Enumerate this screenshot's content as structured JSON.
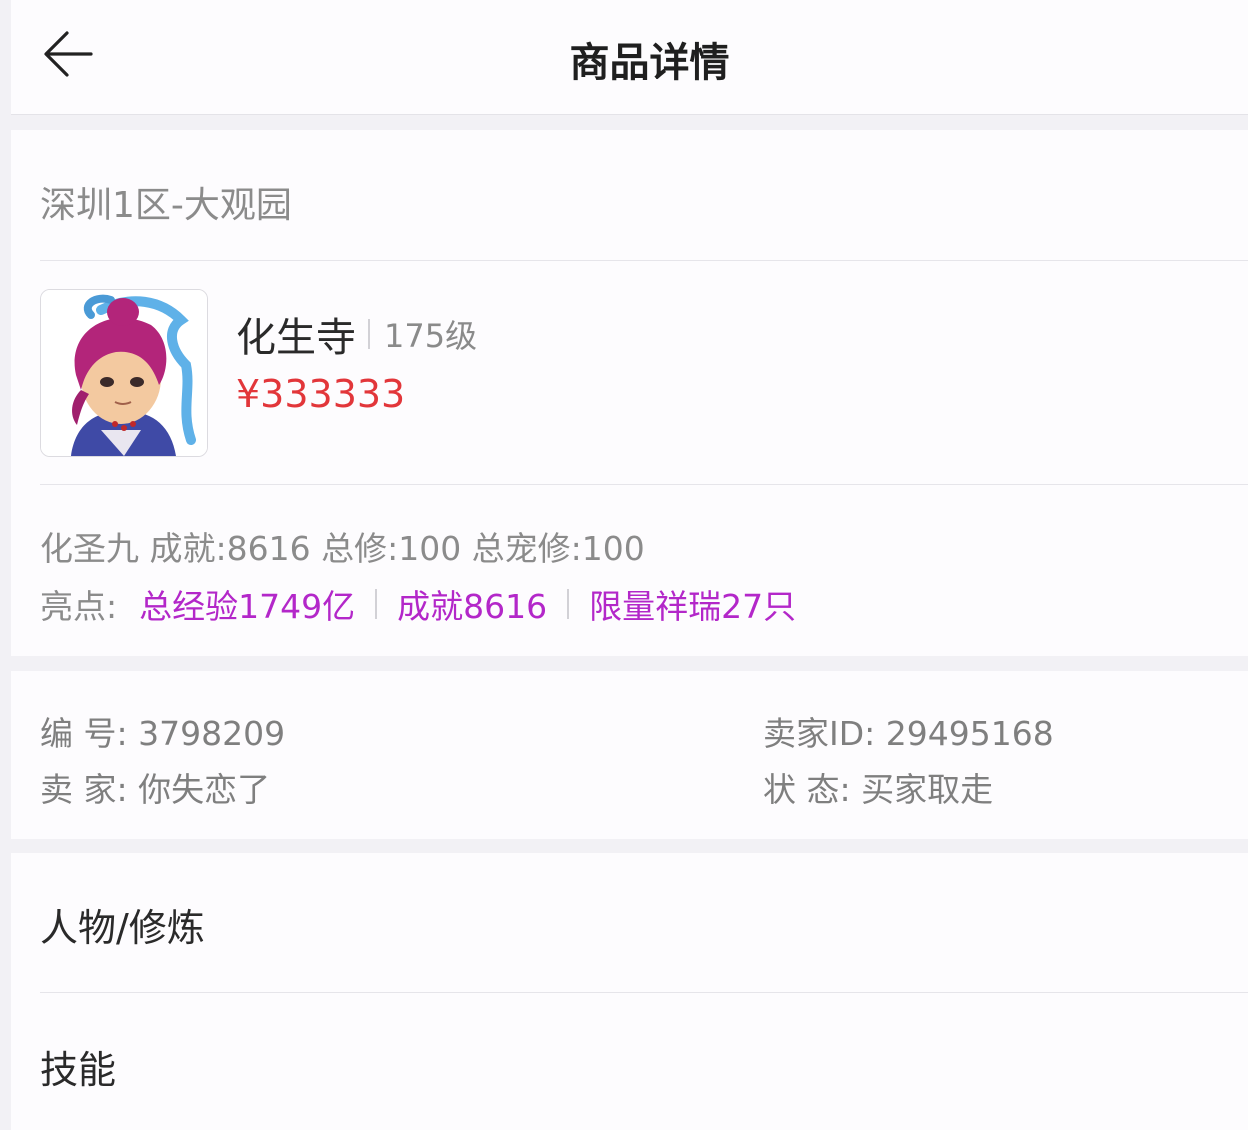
{
  "header": {
    "title": "商品详情",
    "back_icon": "arrow-left-icon"
  },
  "product": {
    "server": "深圳1区-大观园",
    "name": "化生寺",
    "level": "175级",
    "price": "¥333333",
    "stats": "化圣九 成就:8616 总修:100 总宠修:100",
    "highlights_label": "亮点:",
    "highlights": [
      "总经验1749亿",
      "成就8616",
      "限量祥瑞27只"
    ]
  },
  "info": {
    "id_label": "编 号: 3798209",
    "seller_label": "卖 家: 你失恋了",
    "seller_id_label": "卖家ID: 29495168",
    "status_label": "状 态: 买家取走"
  },
  "sections": [
    "人物/修炼",
    "技能"
  ],
  "colors": {
    "price": "#e2363a",
    "highlight": "#b327c9",
    "background": "#f2f1f5",
    "card": "#fdfcfe"
  }
}
